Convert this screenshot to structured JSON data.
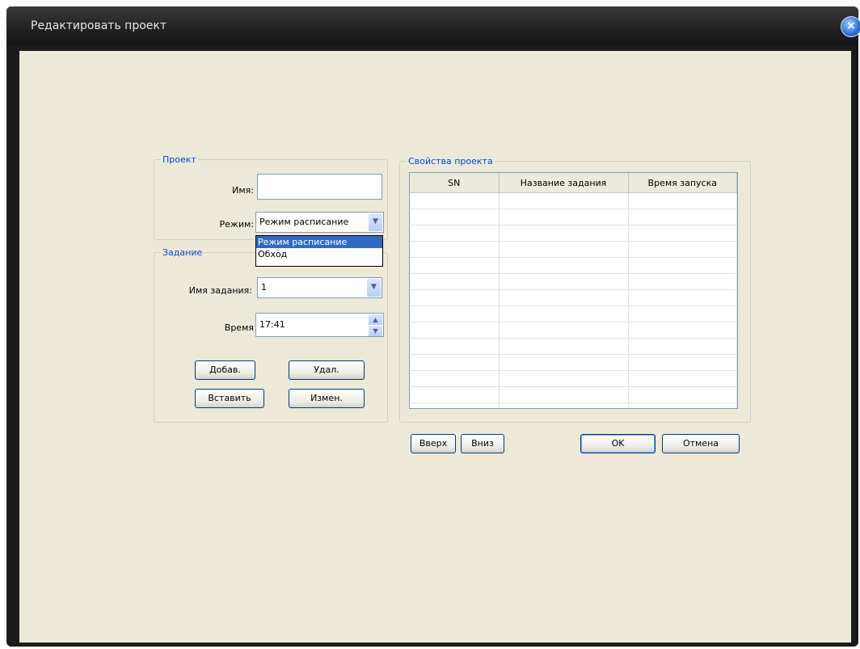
{
  "window": {
    "title": "Редактировать проект"
  },
  "project_group": {
    "legend": "Проект",
    "name_label": "Имя:",
    "name_value": "",
    "mode_label": "Режим:",
    "mode_value": "Режим расписание",
    "mode_options": [
      "Режим расписание",
      "Обход"
    ]
  },
  "task_group": {
    "legend": "Задание",
    "task_name_label": "Имя задания:",
    "task_name_value": "1",
    "time_label": "Время",
    "time_value": "17:41",
    "buttons": {
      "add": "Добав.",
      "delete": "Удал.",
      "insert": "Вставить",
      "edit": "Измен."
    }
  },
  "properties_group": {
    "legend": "Свойства проекта",
    "columns": [
      "SN",
      "Название задания",
      "Время запуска"
    ]
  },
  "footer": {
    "up": "Вверх",
    "down": "Вниз",
    "ok": "OK",
    "cancel": "Отмена"
  }
}
